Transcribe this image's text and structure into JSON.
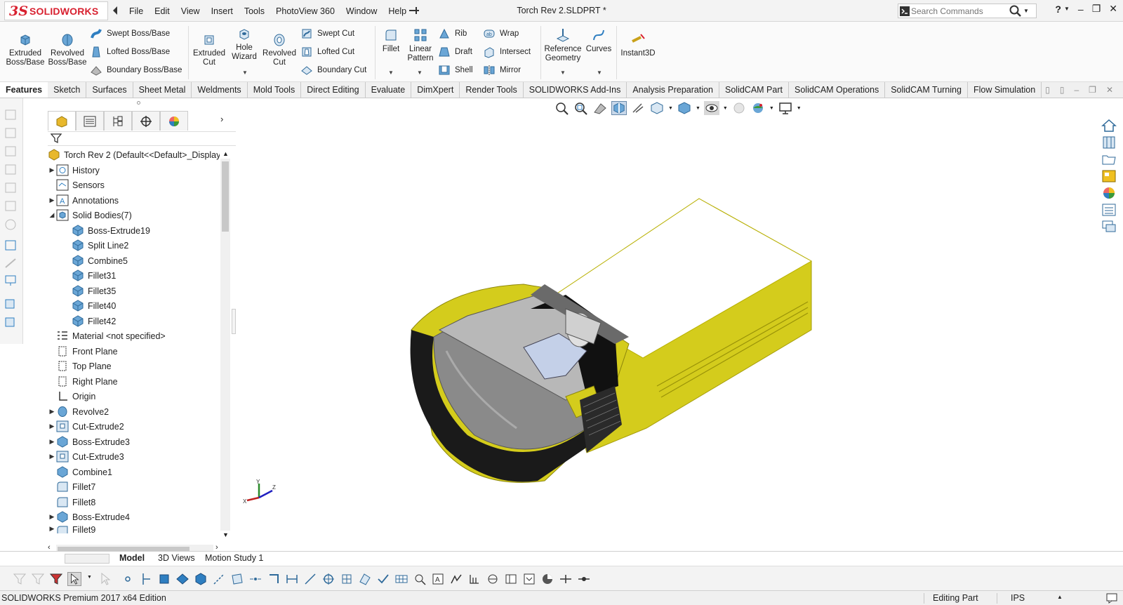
{
  "titlebar": {
    "logo_ds": "3S",
    "logo_text": "SOLIDWORKS",
    "menus": [
      "File",
      "Edit",
      "View",
      "Insert",
      "Tools",
      "PhotoView 360",
      "Window",
      "Help"
    ],
    "doc_title": "Torch Rev 2.SLDPRT *",
    "search_placeholder": "Search Commands",
    "help": "?"
  },
  "ribbon": {
    "extruded_boss": [
      "Extruded",
      "Boss/Base"
    ],
    "revolved_boss": [
      "Revolved",
      "Boss/Base"
    ],
    "swept_boss": "Swept Boss/Base",
    "lofted_boss": "Lofted Boss/Base",
    "boundary_boss": "Boundary Boss/Base",
    "extruded_cut": [
      "Extruded",
      "Cut"
    ],
    "hole_wizard": [
      "Hole",
      "Wizard"
    ],
    "revolved_cut": [
      "Revolved",
      "Cut"
    ],
    "swept_cut": "Swept Cut",
    "lofted_cut": "Lofted Cut",
    "boundary_cut": "Boundary Cut",
    "fillet": "Fillet",
    "linear_pattern": [
      "Linear",
      "Pattern"
    ],
    "rib": "Rib",
    "draft": "Draft",
    "shell": "Shell",
    "wrap": "Wrap",
    "intersect": "Intersect",
    "mirror": "Mirror",
    "reference_geometry": [
      "Reference",
      "Geometry"
    ],
    "curves": "Curves",
    "instant3d": "Instant3D"
  },
  "command_tabs": [
    "Features",
    "Sketch",
    "Surfaces",
    "Sheet Metal",
    "Weldments",
    "Mold Tools",
    "Direct Editing",
    "Evaluate",
    "DimXpert",
    "Render Tools",
    "SOLIDWORKS Add-Ins",
    "Analysis Preparation",
    "SolidCAM Part",
    "SolidCAM Operations",
    "SolidCAM Turning",
    "Flow Simulation"
  ],
  "tree": {
    "root": "Torch Rev 2  (Default<<Default>_Display St",
    "history": "History",
    "sensors": "Sensors",
    "annotations": "Annotations",
    "solid_bodies": "Solid Bodies(7)",
    "bodies": [
      "Boss-Extrude19",
      "Split Line2",
      "Combine5",
      "Fillet31",
      "Fillet35",
      "Fillet40",
      "Fillet42"
    ],
    "material": "Material <not specified>",
    "front_plane": "Front Plane",
    "top_plane": "Top Plane",
    "right_plane": "Right Plane",
    "origin": "Origin",
    "features": [
      "Revolve2",
      "Cut-Extrude2",
      "Boss-Extrude3",
      "Cut-Extrude3",
      "Combine1",
      "Fillet7",
      "Fillet8",
      "Boss-Extrude4",
      "Fillet9"
    ]
  },
  "bottom_tabs": [
    "Model",
    "3D Views",
    "Motion Study 1"
  ],
  "status": {
    "edition": "SOLIDWORKS Premium 2017 x64 Edition",
    "mode": "Editing Part",
    "units": "IPS"
  },
  "colors": {
    "brand_red": "#d8202f",
    "model_yellow": "#d8d21a",
    "icon_blue": "#2f7fc1"
  },
  "icons": {
    "search": "search-icon",
    "feature_manager": "feature-manager-icon",
    "property_manager": "property-manager-icon",
    "configuration_manager": "configuration-manager-icon",
    "dimxpert_manager": "dimxpert-manager-icon",
    "display_manager": "display-manager-icon",
    "filter": "filter-icon"
  }
}
